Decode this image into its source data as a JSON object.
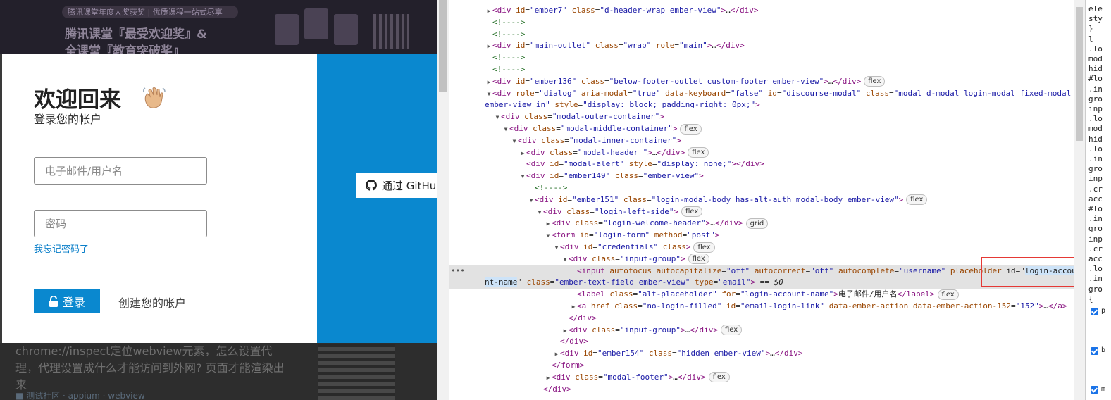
{
  "page": {
    "banner_pill_text": "腾讯课堂年度大奖获奖 | 优质课程一站式尽享",
    "banner_title": "腾讯课堂『最受欢迎奖』&",
    "banner_subtitle": "全课堂『教育突破奖』",
    "article_text": "chrome://inspect定位webview元素，怎么设置代理，代理设置成什么才能访问到外网? 页面才能渲染出来",
    "article_tags": "■ 测试社区 · appium · webview"
  },
  "modal": {
    "title": "欢迎回来",
    "subtitle": "登录您的帐户",
    "username_placeholder": "电子邮件/用户名",
    "password_placeholder": "密码",
    "forgot_password": "我忘记密码了",
    "login_button": "登录",
    "create_account": "创建您的帐户",
    "github_button": "通过 GitHub"
  },
  "devtools": {
    "lines": [
      {
        "indent": 4,
        "tri": "▶",
        "html": "<span class=\"tag\">&lt;div</span> <span class=\"attr\">id</span>=<span class=\"val\">\"ember7\"</span> <span class=\"attr\">class</span>=<span class=\"val\">\"d-header-wrap ember-view\"</span><span class=\"tag\">&gt;</span>…<span class=\"tag\">&lt;/div&gt;</span>"
      },
      {
        "indent": 4,
        "tri": "",
        "html": "<span class=\"cmt\">&lt;!----&gt;</span>"
      },
      {
        "indent": 4,
        "tri": "",
        "html": "<span class=\"cmt\">&lt;!----&gt;</span>"
      },
      {
        "indent": 4,
        "tri": "▶",
        "html": "<span class=\"tag\">&lt;div</span> <span class=\"attr\">id</span>=<span class=\"val\">\"main-outlet\"</span> <span class=\"attr\">class</span>=<span class=\"val\">\"wrap\"</span> <span class=\"attr\">role</span>=<span class=\"val\">\"main\"</span><span class=\"tag\">&gt;</span>…<span class=\"tag\">&lt;/div&gt;</span>"
      },
      {
        "indent": 4,
        "tri": "",
        "html": "<span class=\"cmt\">&lt;!----&gt;</span>"
      },
      {
        "indent": 4,
        "tri": "",
        "html": "<span class=\"cmt\">&lt;!----&gt;</span>"
      },
      {
        "indent": 4,
        "tri": "▶",
        "html": "<span class=\"tag\">&lt;div</span> <span class=\"attr\">id</span>=<span class=\"val\">\"ember136\"</span> <span class=\"attr\">class</span>=<span class=\"val\">\"below-footer-outlet custom-footer ember-view\"</span><span class=\"tag\">&gt;</span>…<span class=\"tag\">&lt;/div&gt;</span>",
        "badge": "flex"
      },
      {
        "indent": 4,
        "tri": "▼",
        "html": "<span class=\"tag\">&lt;div</span> <span class=\"attr\">role</span>=<span class=\"val\">\"dialog\"</span> <span class=\"attr\">aria-modal</span>=<span class=\"val\">\"true\"</span> <span class=\"attr\">data-keyboard</span>=<span class=\"val\">\"false\"</span> <span class=\"attr\">id</span>=<span class=\"val\">\"discourse-modal\"</span> <span class=\"attr\">class</span>=<span class=\"val\">\"modal d-modal login-modal fixed-modal</span>"
      },
      {
        "indent": 1,
        "tri": "",
        "html": "<span class=\"val\">ember-view in\"</span> <span class=\"attr\">style</span>=<span class=\"val\">\"display: block; padding-right: 0px;\"</span><span class=\"tag\">&gt;</span>"
      },
      {
        "indent": 5,
        "tri": "▼",
        "html": "<span class=\"tag\">&lt;div</span> <span class=\"attr\">class</span>=<span class=\"val\">\"modal-outer-container\"</span><span class=\"tag\">&gt;</span>"
      },
      {
        "indent": 6,
        "tri": "▼",
        "html": "<span class=\"tag\">&lt;div</span> <span class=\"attr\">class</span>=<span class=\"val\">\"modal-middle-container\"</span><span class=\"tag\">&gt;</span>",
        "badge": "flex"
      },
      {
        "indent": 7,
        "tri": "▼",
        "html": "<span class=\"tag\">&lt;div</span> <span class=\"attr\">class</span>=<span class=\"val\">\"modal-inner-container\"</span><span class=\"tag\">&gt;</span>"
      },
      {
        "indent": 8,
        "tri": "▶",
        "html": "<span class=\"tag\">&lt;div</span> <span class=\"attr\">class</span>=<span class=\"val\">\"modal-header \"</span><span class=\"tag\">&gt;</span>…<span class=\"tag\">&lt;/div&gt;</span>",
        "badge": "flex"
      },
      {
        "indent": 8,
        "tri": "",
        "html": "<span class=\"tag\">&lt;div</span> <span class=\"attr\">id</span>=<span class=\"val\">\"modal-alert\"</span> <span class=\"attr\">style</span>=<span class=\"val\">\"display: none;\"</span><span class=\"tag\">&gt;&lt;/div&gt;</span>"
      },
      {
        "indent": 8,
        "tri": "▼",
        "html": "<span class=\"tag\">&lt;div</span> <span class=\"attr\">id</span>=<span class=\"val\">\"ember149\"</span> <span class=\"attr\">class</span>=<span class=\"val\">\"ember-view\"</span><span class=\"tag\">&gt;</span>"
      },
      {
        "indent": 9,
        "tri": "",
        "html": "<span class=\"cmt\">&lt;!----&gt;</span>"
      },
      {
        "indent": 9,
        "tri": "▼",
        "html": "<span class=\"tag\">&lt;div</span> <span class=\"attr\">id</span>=<span class=\"val\">\"ember151\"</span> <span class=\"attr\">class</span>=<span class=\"val\">\"login-modal-body has-alt-auth modal-body ember-view\"</span><span class=\"tag\">&gt;</span>",
        "badge": "flex"
      },
      {
        "indent": 10,
        "tri": "▼",
        "html": "<span class=\"tag\">&lt;div</span> <span class=\"attr\">class</span>=<span class=\"val\">\"login-left-side\"</span><span class=\"tag\">&gt;</span>",
        "badge": "flex"
      },
      {
        "indent": 11,
        "tri": "▶",
        "html": "<span class=\"tag\">&lt;div</span> <span class=\"attr\">class</span>=<span class=\"val\">\"login-welcome-header\"</span><span class=\"tag\">&gt;</span>…<span class=\"tag\">&lt;/div&gt;</span>",
        "badge": "grid"
      },
      {
        "indent": 11,
        "tri": "▼",
        "html": "<span class=\"tag\">&lt;form</span> <span class=\"attr\">id</span>=<span class=\"val\">\"login-form\"</span> <span class=\"attr\">method</span>=<span class=\"val\">\"post\"</span><span class=\"tag\">&gt;</span>"
      },
      {
        "indent": 12,
        "tri": "▼",
        "html": "<span class=\"tag\">&lt;div</span> <span class=\"attr\">id</span>=<span class=\"val\">\"credentials\"</span> <span class=\"attr\">class</span><span class=\"tag\">&gt;</span>",
        "badge": "flex"
      },
      {
        "indent": 13,
        "tri": "▼",
        "html": "<span class=\"tag\">&lt;div</span> <span class=\"attr\">class</span>=<span class=\"val\">\"input-group\"</span><span class=\"tag\">&gt;</span>",
        "badge": "flex"
      },
      {
        "indent": 14,
        "tri": "",
        "html": "<span class=\"tag\">&lt;input</span> <span class=\"attr\">autofocus</span> <span class=\"attr\">autocapitalize</span>=<span class=\"val\">\"off\"</span> <span class=\"attr\">autocorrect</span>=<span class=\"val\">\"off\"</span> <span class=\"attr\">autocomplete</span>=<span class=\"val\">\"username\"</span> <span class=\"attr\">placeholder</span> <span class=\"txt\">id=\"</span><span class=\"hl\">login-accou</span>"
      },
      {
        "indent": 1,
        "tri": "",
        "html": "<span class=\"hl\">nt-name</span><span class=\"txt\">\"</span> <span class=\"attr\">class</span>=<span class=\"val\">\"ember-text-field ember-view\"</span> <span class=\"attr\">type</span>=<span class=\"val\">\"email\"</span><span class=\"tag\">&gt;</span> <span class=\"txt\">== </span><span class=\"txt\"><i>$0</i></span>"
      },
      {
        "indent": 14,
        "tri": "",
        "html": "<span class=\"tag\">&lt;label</span> <span class=\"attr\">class</span>=<span class=\"val\">\"alt-placeholder\"</span> <span class=\"attr\">for</span>=<span class=\"val\">\"login-account-name\"</span><span class=\"tag\">&gt;</span><span class=\"txt\">电子邮件/用户名</span><span class=\"tag\">&lt;/label&gt;</span>",
        "badge": "flex"
      },
      {
        "indent": 14,
        "tri": "▶",
        "html": "<span class=\"tag\">&lt;a</span> <span class=\"attr\">href</span> <span class=\"attr\">class</span>=<span class=\"val\">\"no-login-filled\"</span> <span class=\"attr\">id</span>=<span class=\"val\">\"email-login-link\"</span> <span class=\"attr\">data-ember-action</span> <span class=\"attr\">data-ember-action-152</span>=<span class=\"val\">\"152\"</span><span class=\"tag\">&gt;</span>…<span class=\"tag\">&lt;/a&gt;</span>"
      },
      {
        "indent": 13,
        "tri": "",
        "html": "<span class=\"tag\">&lt;/div&gt;</span>"
      },
      {
        "indent": 13,
        "tri": "▶",
        "html": "<span class=\"tag\">&lt;div</span> <span class=\"attr\">class</span>=<span class=\"val\">\"input-group\"</span><span class=\"tag\">&gt;</span>…<span class=\"tag\">&lt;/div&gt;</span>",
        "badge": "flex"
      },
      {
        "indent": 12,
        "tri": "",
        "html": "<span class=\"tag\">&lt;/div&gt;</span>"
      },
      {
        "indent": 12,
        "tri": "▶",
        "html": "<span class=\"tag\">&lt;div</span> <span class=\"attr\">id</span>=<span class=\"val\">\"ember154\"</span> <span class=\"attr\">class</span>=<span class=\"val\">\"hidden ember-view\"</span><span class=\"tag\">&gt;</span>…<span class=\"tag\">&lt;/div&gt;</span>"
      },
      {
        "indent": 11,
        "tri": "",
        "html": "<span class=\"tag\">&lt;/form&gt;</span>"
      },
      {
        "indent": 11,
        "tri": "▶",
        "html": "<span class=\"tag\">&lt;div</span> <span class=\"attr\">class</span>=<span class=\"val\">\"modal-footer\"</span><span class=\"tag\">&gt;</span>…<span class=\"tag\">&lt;/div&gt;</span>",
        "badge": "flex"
      },
      {
        "indent": 10,
        "tri": "",
        "html": "<span class=\"tag\">&lt;/div&gt;</span>"
      }
    ]
  },
  "styles_pane": {
    "lines": [
      "ele",
      "sty",
      "}",
      "  l",
      ".lo",
      "mod",
      "hid",
      "#lo",
      ".in",
      "gro",
      "inp",
      ".lo",
      "mod",
      "hid",
      ".lo",
      ".in",
      "gro",
      "inp",
      ".cr",
      "acc",
      "#lo",
      ".in",
      "gro",
      "inp",
      ".cr",
      "acc",
      ".lo",
      ".in",
      "gro",
      "{"
    ],
    "checkbox_labels": [
      "p",
      "b",
      "m"
    ]
  },
  "colors": {
    "accent": "#0a88cf",
    "link": "#0a7fc9",
    "tag": "#881280",
    "attr": "#994500",
    "value": "#1a1aa6",
    "comment": "#236e25",
    "highlight_box": "#e53935"
  }
}
